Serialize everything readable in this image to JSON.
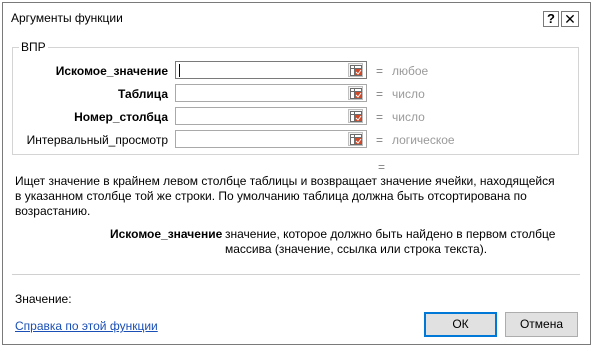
{
  "window": {
    "title": "Аргументы функции",
    "help_label": "?",
    "close_label": "✕"
  },
  "function_group": {
    "name": "ВПР",
    "arguments": [
      {
        "label": "Искомое_значение",
        "value": "",
        "type_hint": "любое",
        "bold": true
      },
      {
        "label": "Таблица",
        "value": "",
        "type_hint": "число",
        "bold": true
      },
      {
        "label": "Номер_столбца",
        "value": "",
        "type_hint": "число",
        "bold": true
      },
      {
        "label": "Интервальный_просмотр",
        "value": "",
        "type_hint": "логическое",
        "bold": false
      }
    ],
    "equals_sign": "="
  },
  "result_equals": "=",
  "description": "Ищет значение в крайнем левом столбце таблицы и возвращает значение ячейки, находящейся в указанном столбце той же строки. По умолчанию таблица должна быть отсортирована по возрастанию.",
  "argument_help": {
    "name": "Искомое_значение",
    "text": "значение, которое должно быть найдено в первом столбце массива (значение, ссылка или строка текста)."
  },
  "value_label": "Значение:",
  "help_link": "Справка по этой функции",
  "buttons": {
    "ok": "ОК",
    "cancel": "Отмена"
  },
  "icons": {
    "collapse_dialog": "range-select-icon"
  },
  "colors": {
    "link": "#1a4fb6",
    "default_button_border": "#0078d7",
    "hint_text": "#9a9a9a"
  }
}
